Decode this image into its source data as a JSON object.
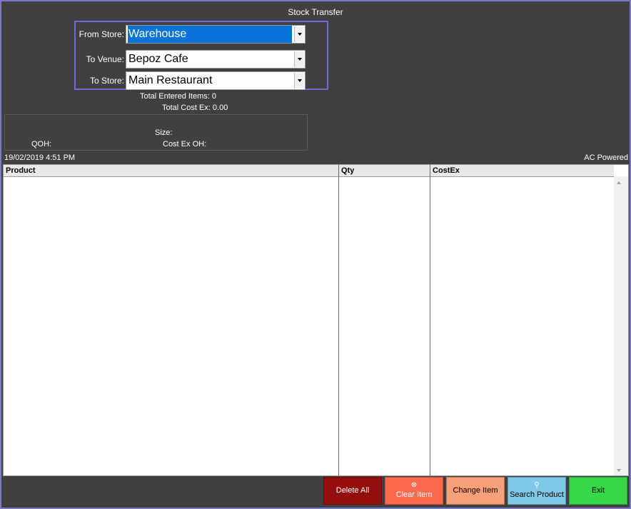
{
  "window": {
    "title": "Stock Transfer"
  },
  "form": {
    "from_store_label": "From Store:",
    "from_store_value": "Warehouse",
    "to_venue_label": "To Venue:",
    "to_venue_value": "Bepoz Cafe",
    "to_store_label": "To Store:",
    "to_store_value": "Main Restaurant"
  },
  "totals": {
    "items": "Total Entered Items: 0",
    "cost": "Total Cost Ex: 0.00"
  },
  "detail": {
    "size_label": "Size:",
    "qoh_label": "QOH:",
    "cost_oh_label": "Cost Ex OH:"
  },
  "status": {
    "datetime": "19/02/2019 4:51 PM",
    "power": "AC Powered"
  },
  "table": {
    "columns": [
      "Product",
      "Qty",
      "CostEx"
    ],
    "rows": []
  },
  "buttons": {
    "delete_all": "Delete All",
    "clear_item": "Clear Item",
    "change_item": "Change Item",
    "search_product": "Search Product",
    "exit": "Exit"
  },
  "icons": {
    "clear_item": "close-circle-icon",
    "search_product": "search-icon"
  },
  "colors": {
    "background": "#404040",
    "selection": "#0a74d6",
    "store_box_border": "#6d6bd8",
    "delete_all": "#950e0e",
    "clear_item": "#ff6a4f",
    "change_item": "#f6a07a",
    "search_product": "#7ec8e8",
    "exit": "#36d84a"
  }
}
